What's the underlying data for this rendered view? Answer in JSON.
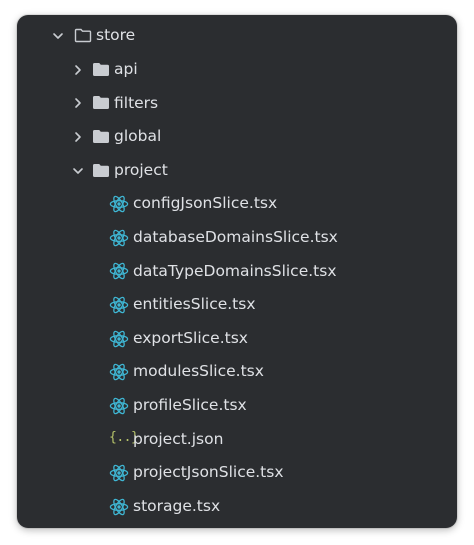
{
  "tree": {
    "root": {
      "label": "store",
      "expanded": true
    },
    "folders": [
      {
        "label": "api",
        "expanded": false
      },
      {
        "label": "filters",
        "expanded": false
      },
      {
        "label": "global",
        "expanded": false
      },
      {
        "label": "project",
        "expanded": true
      }
    ],
    "files": [
      {
        "label": "configJsonSlice.tsx",
        "icon": "react-icon"
      },
      {
        "label": "databaseDomainsSlice.tsx",
        "icon": "react-icon"
      },
      {
        "label": "dataTypeDomainsSlice.tsx",
        "icon": "react-icon"
      },
      {
        "label": "entitiesSlice.tsx",
        "icon": "react-icon"
      },
      {
        "label": "exportSlice.tsx",
        "icon": "react-icon"
      },
      {
        "label": "modulesSlice.tsx",
        "icon": "react-icon"
      },
      {
        "label": "profileSlice.tsx",
        "icon": "react-icon"
      },
      {
        "label": "project.json",
        "icon": "json-icon",
        "icon_text": "{..}"
      },
      {
        "label": "projectJsonSlice.tsx",
        "icon": "react-icon"
      },
      {
        "label": "storage.tsx",
        "icon": "react-icon"
      }
    ]
  },
  "colors": {
    "panel_background": "#2b2d30",
    "text": "#dfe1e5",
    "react_icon": "#3fb6d3",
    "json_icon": "#b7c46a",
    "folder_outline": "#c9ccd1",
    "folder_fill": "#c9ccd1"
  }
}
